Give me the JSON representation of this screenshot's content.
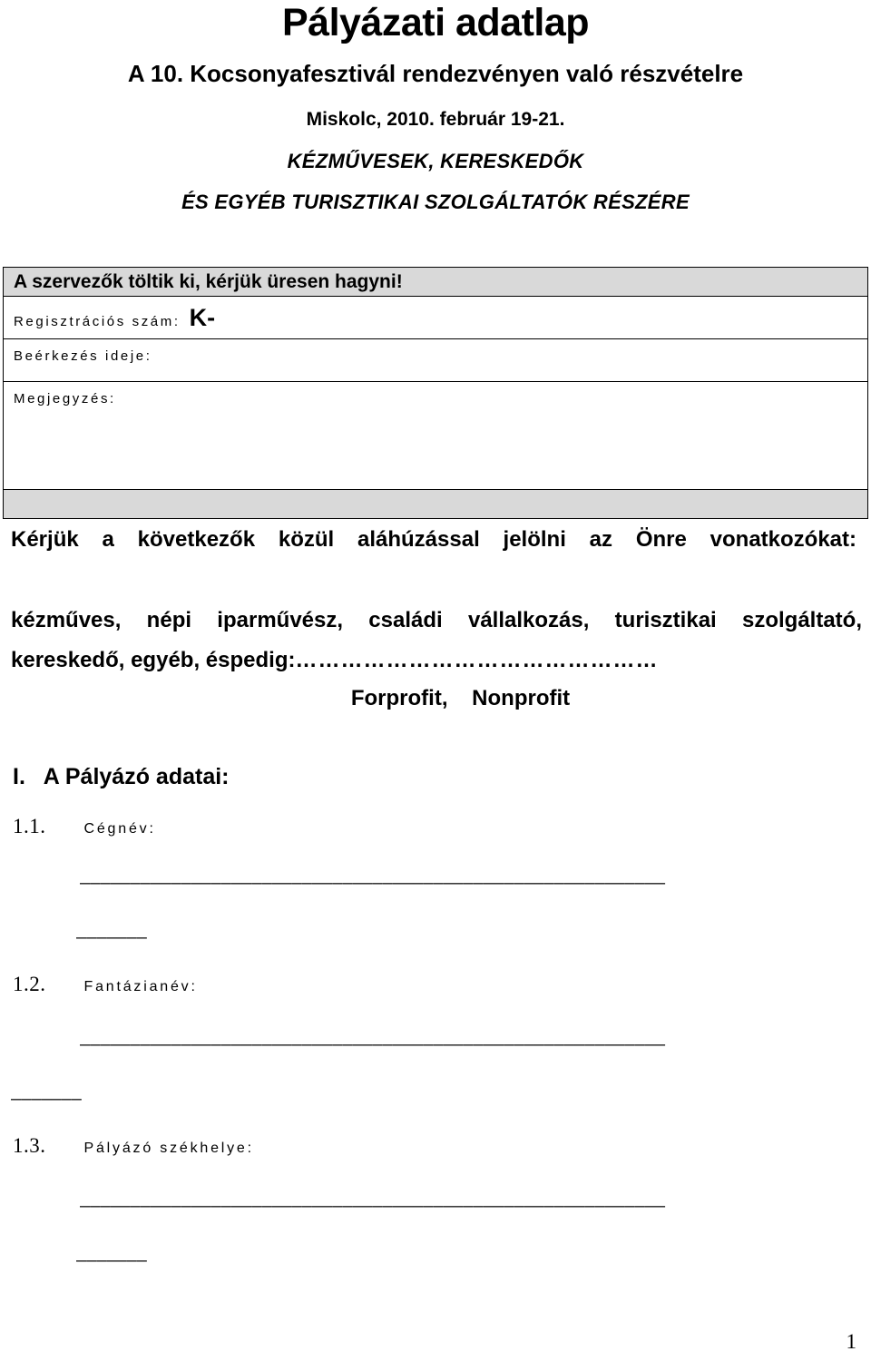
{
  "document": {
    "title": "Pályázati adatlap",
    "subtitle_event": "A 10. Kocsonyafesztivál rendezvényen való részvételre",
    "subtitle_place_date": "Miskolc, 2010. február 19-21.",
    "audience_line_1": "KÉZMŰVESEK, KERESKEDŐK",
    "audience_line_2": "ÉS EGYÉB TURISZTIKAI SZOLGÁLTATÓK RÉSZÉRE",
    "page_number": "1"
  },
  "organizers_box": {
    "header": "A szervezők töltik ki, kérjük üresen hagyni!",
    "registration_label": "Regisztrációs szám:",
    "registration_value": "K-",
    "arrival_label": "Beérkezés ideje:",
    "arrival_value": "",
    "note_label": "Megjegyzés:",
    "note_value": "",
    "header_bg": "#d9d9d9",
    "footer_bg": "#d9d9d9"
  },
  "instructions": {
    "select_line": "Kérjük a következők közül aláhúzással jelölni az Önre vonatkozókat:",
    "categories": "kézműves, népi iparművész, családi vállalkozás, turisztikai szolgáltató, kereskedő, egyéb, éspedig:",
    "category_dots": "…………………………………………",
    "profit_options": "Forprofit,    Nonprofit"
  },
  "section_one": {
    "heading": "I.   A Pályázó adatai:",
    "items": [
      {
        "number": "1.1.",
        "label": "Cégnév:",
        "value": ""
      },
      {
        "number": "1.2.",
        "label": "Fantázianév:",
        "value": ""
      },
      {
        "number": "1.3.",
        "label": "Pályázó székhelye:",
        "value": ""
      }
    ],
    "fill_line_long": "––––––––––––––––––––––––––––––––––––––––––––––––––––––––––",
    "fill_line_short": "–––––––"
  }
}
